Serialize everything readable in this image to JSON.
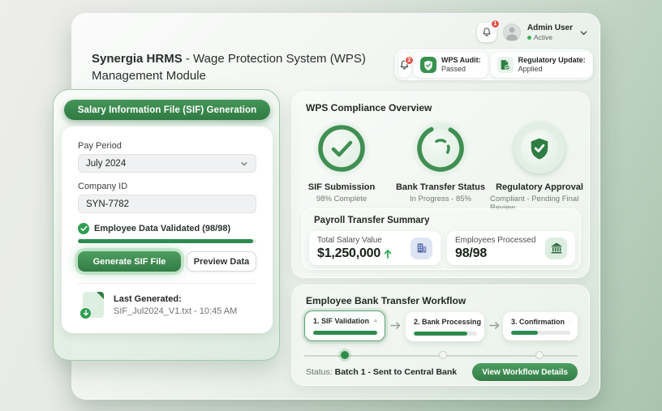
{
  "header": {
    "title_bold": "Synergia HRMS",
    "title_rest": " - Wage Protection System (WPS)",
    "title_line2": "Management Module"
  },
  "topbar": {
    "notification_count": "1",
    "user_name": "Admin User",
    "user_status": "Active"
  },
  "status_badges": {
    "bell_count": "2",
    "wps_audit_label": "WPS Audit:",
    "wps_audit_value": "Passed",
    "regulatory_label": "Regulatory Update:",
    "regulatory_value": "Applied"
  },
  "sif_panel": {
    "header": "Salary Information File (SIF) Generation",
    "pay_period_label": "Pay Period",
    "pay_period_value": "July 2024",
    "company_id_label": "Company ID",
    "company_id_value": "SYN-7782",
    "validation_text": "Employee Data Validated (98/98)",
    "validation_progress": 98,
    "generate_button": "Generate SIF File",
    "preview_button": "Preview Data",
    "last_generated_label": "Last Generated:",
    "last_generated_value": "SIF_Jul2024_V1.txt - 10:45 AM"
  },
  "compliance": {
    "title": "WPS Compliance Overview",
    "indicators": [
      {
        "label": "SIF Submission",
        "sublabel": "98% Complete",
        "icon": "check-ring",
        "progress": 98
      },
      {
        "label": "Bank Transfer Status",
        "sublabel": "In Progress - 85%",
        "icon": "spinner-ring",
        "progress": 85
      },
      {
        "label": "Regulatory Approval",
        "sublabel": "Compliant - Pending Final Review",
        "icon": "shield-check"
      }
    ],
    "payroll_summary": {
      "title": "Payroll Transfer Summary",
      "stats": [
        {
          "label": "Total Salary Value",
          "value": "$1,250,000",
          "trend": "up",
          "icon": "office-building"
        },
        {
          "label": "Employees Processed",
          "value": "98/98",
          "icon": "bank"
        }
      ]
    }
  },
  "workflow": {
    "title": "Employee Bank Transfer Workflow",
    "steps": [
      {
        "label": "1. SIF Validation",
        "icon": "magnifier",
        "progress": 100,
        "active": true
      },
      {
        "label": "2. Bank Processing",
        "icon": "bank",
        "progress": 85,
        "active": false
      },
      {
        "label": "3. Confirmation",
        "icon": "handshake",
        "progress": 45,
        "active": false
      }
    ],
    "status_label": "Status: ",
    "status_value": "Batch 1 - Sent to Central Bank",
    "details_button": "View Workflow Details"
  },
  "colors": {
    "primary_green": "#35824a",
    "light_green": "#dff0e2",
    "badge_red": "#e2544b",
    "icon_blue": "#5a6fae",
    "text_dark": "#232b26"
  }
}
